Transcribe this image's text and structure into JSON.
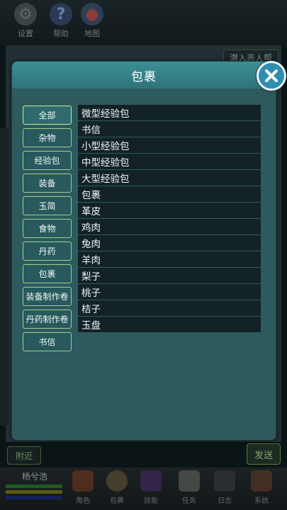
{
  "background": {
    "toolbar": [
      {
        "icon": "gear-icon",
        "label": "设置"
      },
      {
        "icon": "question-icon",
        "label": "帮助"
      },
      {
        "icon": "map-pin-icon",
        "label": "地图"
      }
    ],
    "join_label": "潜入恶人帮",
    "nearby_label": "附近",
    "send_label": "发送",
    "player_name": "杨兮浩",
    "nav": [
      {
        "icon": "scroll-icon",
        "label": "角色"
      },
      {
        "icon": "bag-icon",
        "label": "包裹"
      },
      {
        "icon": "skill-icon",
        "label": "技能"
      },
      {
        "icon": "mail-icon",
        "label": "任务"
      },
      {
        "icon": "book-icon",
        "label": "日志"
      },
      {
        "icon": "quill-icon",
        "label": "系统"
      }
    ]
  },
  "dialog": {
    "title": "包裹",
    "close_icon": "close-icon",
    "categories": [
      "全部",
      "杂物",
      "经验包",
      "装备",
      "玉简",
      "食物",
      "丹药",
      "包裹",
      "装备制作卷",
      "丹药制作卷",
      "书信"
    ],
    "selected_category": "全部",
    "items": [
      "微型经验包",
      "书信",
      "小型经验包",
      "中型经验包",
      "大型经验包",
      "包裹",
      "革皮",
      "鸡肉",
      "兔肉",
      "羊肉",
      "梨子",
      "桃子",
      "桔子",
      "玉盘"
    ]
  },
  "colors": {
    "dialog_bg": "#2d5a5e",
    "header_bg": "#3b8f95",
    "button_border": "#9fcf8e",
    "item_bg": "#132227",
    "close_bg": "#2f8eb0"
  }
}
